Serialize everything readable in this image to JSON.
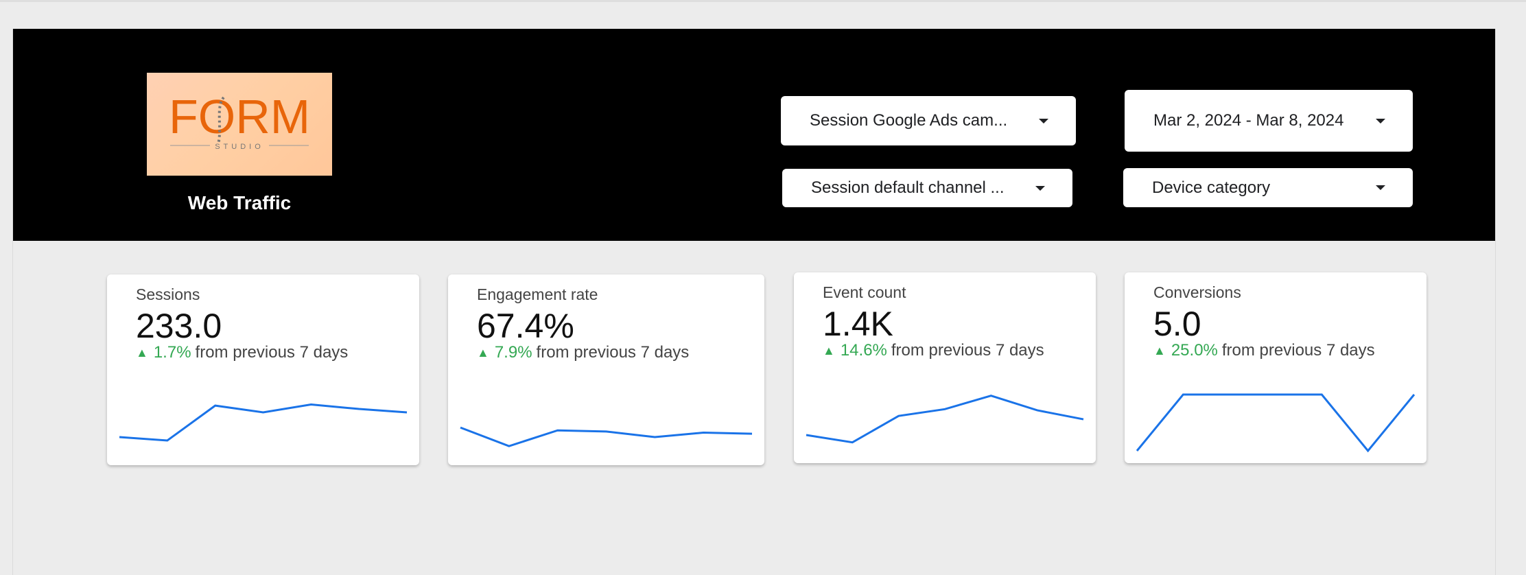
{
  "header": {
    "logo": {
      "main_text": "FORM",
      "sub_text": "STUDIO",
      "background": "#ffcfa8",
      "text_color": "#e8650a"
    },
    "title": "Web Traffic"
  },
  "filters": {
    "campaign": "Session Google Ads cam...",
    "date_range": "Mar 2, 2024 - Mar 8, 2024",
    "channel": "Session default channel ...",
    "device": "Device category"
  },
  "colors": {
    "header_bg": "#000000",
    "page_bg": "#ececec",
    "positive": "#34a853",
    "spark": "#1a73e8"
  },
  "scorecards": [
    {
      "name": "Sessions",
      "value": "233.0",
      "delta": "1.7%",
      "delta_suffix": "from previous 7 days",
      "sparkline": [
        0.28,
        0.22,
        0.84,
        0.72,
        0.86,
        0.78,
        0.72
      ]
    },
    {
      "name": "Engagement rate",
      "value": "67.4%",
      "delta": "7.9%",
      "delta_suffix": "from previous 7 days",
      "sparkline": [
        0.45,
        0.12,
        0.4,
        0.38,
        0.28,
        0.36,
        0.34
      ]
    },
    {
      "name": "Event count",
      "value": "1.4K",
      "delta": "14.6%",
      "delta_suffix": "from previous 7 days",
      "sparkline": [
        0.28,
        0.15,
        0.62,
        0.74,
        0.98,
        0.72,
        0.56
      ]
    },
    {
      "name": "Conversions",
      "value": "5.0",
      "delta": "25.0%",
      "delta_suffix": "from previous 7 days",
      "sparkline": [
        0,
        1,
        1,
        1,
        1,
        0,
        1
      ]
    }
  ]
}
